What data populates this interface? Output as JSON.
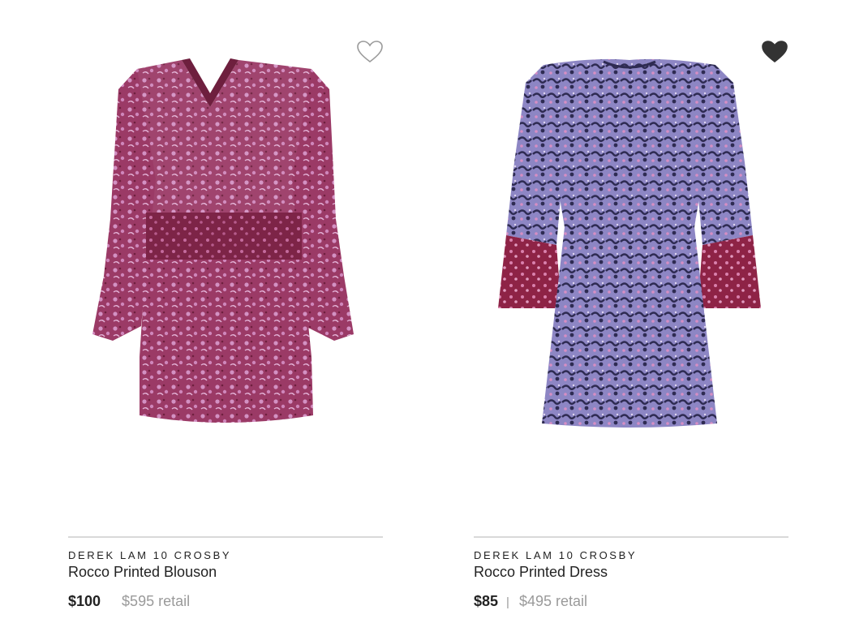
{
  "products": [
    {
      "brand": "DEREK LAM 10 CROSBY",
      "name": "Rocco Printed Blouson",
      "price": "$100",
      "retail": "$595 retail",
      "favorited": false,
      "heart_icon": "heart-outline-icon",
      "colors": {
        "body": "#9b3a66",
        "pattern": "#d391c3",
        "dark": "#6e1f3e"
      }
    },
    {
      "brand": "DEREK LAM 10 CROSBY",
      "name": "Rocco Printed Dress",
      "price": "$85",
      "separator": "|",
      "retail": "$495 retail",
      "favorited": true,
      "heart_icon": "heart-filled-icon",
      "colors": {
        "body": "#8d86c4",
        "pattern": "#2e2b52",
        "cuff": "#8e2346"
      }
    }
  ]
}
